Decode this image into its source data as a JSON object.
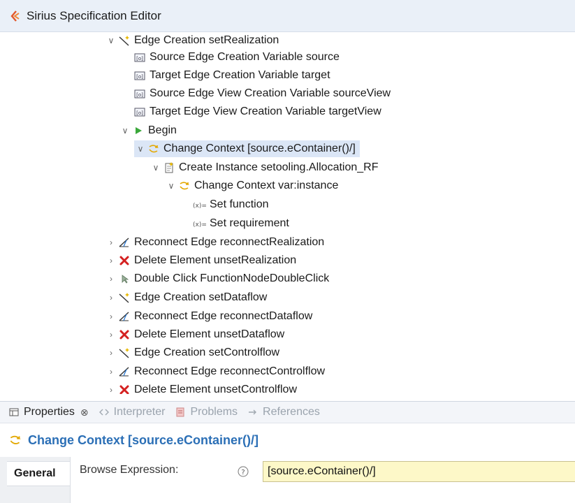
{
  "editor": {
    "title": "Sirius Specification Editor"
  },
  "tree": {
    "rows": [
      {
        "label": "Edge Creation setRealization",
        "icon": "edge-creation-icon",
        "toggle": "expanded"
      },
      {
        "label": "Source Edge Creation Variable source",
        "icon": "variable-icon",
        "toggle": "none"
      },
      {
        "label": "Target Edge Creation Variable target",
        "icon": "variable-icon",
        "toggle": "none"
      },
      {
        "label": "Source Edge View Creation Variable sourceView",
        "icon": "variable-icon",
        "toggle": "none"
      },
      {
        "label": "Target Edge View Creation Variable targetView",
        "icon": "variable-icon",
        "toggle": "none"
      },
      {
        "label": "Begin",
        "icon": "begin-icon",
        "toggle": "expanded"
      },
      {
        "label": "Change Context [source.eContainer()/]",
        "icon": "change-context-icon",
        "toggle": "expanded",
        "selected": true
      },
      {
        "label": "Create Instance setooling.Allocation_RF",
        "icon": "create-instance-icon",
        "toggle": "expanded"
      },
      {
        "label": "Change Context var:instance",
        "icon": "change-context-icon",
        "toggle": "expanded"
      },
      {
        "label": "Set function",
        "icon": "set-icon",
        "toggle": "none"
      },
      {
        "label": "Set requirement",
        "icon": "set-icon",
        "toggle": "none"
      },
      {
        "label": "Reconnect Edge reconnectRealization",
        "icon": "reconnect-edge-icon",
        "toggle": "collapsed"
      },
      {
        "label": "Delete Element unsetRealization",
        "icon": "delete-icon",
        "toggle": "collapsed"
      },
      {
        "label": "Double Click FunctionNodeDoubleClick",
        "icon": "double-click-icon",
        "toggle": "collapsed"
      },
      {
        "label": "Edge Creation setDataflow",
        "icon": "edge-creation-icon",
        "toggle": "collapsed"
      },
      {
        "label": "Reconnect Edge reconnectDataflow",
        "icon": "reconnect-edge-icon",
        "toggle": "collapsed"
      },
      {
        "label": "Delete Element unsetDataflow",
        "icon": "delete-icon",
        "toggle": "collapsed"
      },
      {
        "label": "Edge Creation setControlflow",
        "icon": "edge-creation-icon",
        "toggle": "collapsed"
      },
      {
        "label": "Reconnect Edge reconnectControlflow",
        "icon": "reconnect-edge-icon",
        "toggle": "collapsed"
      },
      {
        "label": "Delete Element unsetControlflow",
        "icon": "delete-icon",
        "toggle": "collapsed"
      }
    ]
  },
  "views": {
    "tabs": [
      {
        "label": "Properties",
        "icon": "properties-icon",
        "active": true
      },
      {
        "label": "Interpreter",
        "icon": "interpreter-icon",
        "active": false
      },
      {
        "label": "Problems",
        "icon": "problems-icon",
        "active": false
      },
      {
        "label": "References",
        "icon": "references-icon",
        "active": false
      }
    ],
    "close_glyph": "⊗"
  },
  "properties": {
    "header": "Change Context [source.eContainer()/]",
    "section": "General",
    "field_label": "Browse Expression:",
    "expression_value": "[source.eContainer()/]"
  },
  "colors": {
    "selection": "#dbe6f6",
    "header_blue": "#2b6fb6",
    "expression_bg": "#fdf8c8"
  }
}
